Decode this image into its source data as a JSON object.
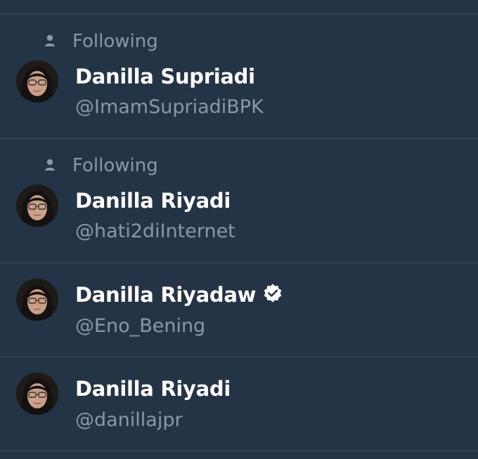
{
  "users": [
    {
      "social_context": "Following",
      "name": "Danilla Supriadi",
      "handle": "@ImamSupriadiBPK",
      "verified": false
    },
    {
      "social_context": "Following",
      "name": "Danilla Riyadi",
      "handle": "@hati2diInternet",
      "verified": false
    },
    {
      "social_context": "",
      "name": "Danilla Riyadaw",
      "handle": "@Eno_Bening",
      "verified": true
    },
    {
      "social_context": "",
      "name": "Danilla Riyadi",
      "handle": "@danillajpr",
      "verified": false
    }
  ],
  "colors": {
    "background": "#243447",
    "divider": "#3d4f63",
    "name": "#ffffff",
    "secondary": "#8899a6"
  },
  "icons": {
    "social_context": "person-icon",
    "verified": "verified-badge-icon"
  }
}
